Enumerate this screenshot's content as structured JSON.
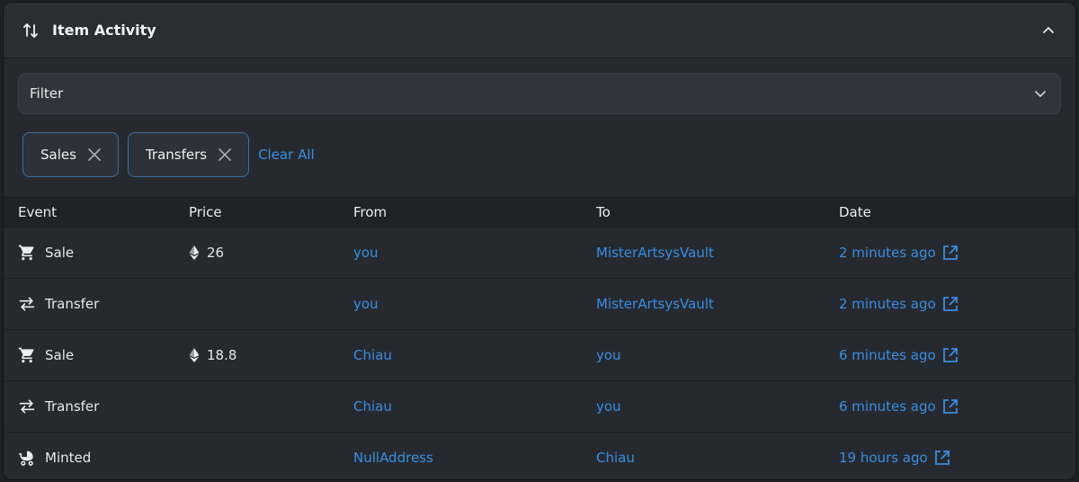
{
  "header": {
    "title": "Item Activity"
  },
  "filter": {
    "label": "Filter"
  },
  "chips": [
    {
      "label": "Sales"
    },
    {
      "label": "Transfers"
    }
  ],
  "clear_all": "Clear All",
  "columns": {
    "event": "Event",
    "price": "Price",
    "from": "From",
    "to": "To",
    "date": "Date"
  },
  "rows": [
    {
      "event": "Sale",
      "icon": "cart-icon",
      "price": "26",
      "from": "you",
      "to": "MisterArtsysVault",
      "date": "2 minutes ago"
    },
    {
      "event": "Transfer",
      "icon": "transfer-arrows-icon",
      "price": "",
      "from": "you",
      "to": "MisterArtsysVault",
      "date": "2 minutes ago"
    },
    {
      "event": "Sale",
      "icon": "cart-icon",
      "price": "18.8",
      "from": "Chiau",
      "to": "you",
      "date": "6 minutes ago"
    },
    {
      "event": "Transfer",
      "icon": "transfer-arrows-icon",
      "price": "",
      "from": "Chiau",
      "to": "you",
      "date": "6 minutes ago"
    },
    {
      "event": "Minted",
      "icon": "stroller-icon",
      "price": "",
      "from": "NullAddress",
      "to": "Chiau",
      "date": "19 hours ago"
    }
  ],
  "colors": {
    "link": "#3a8de0",
    "chip_border": "#3f6f9c",
    "panel_bg": "#262a30"
  }
}
